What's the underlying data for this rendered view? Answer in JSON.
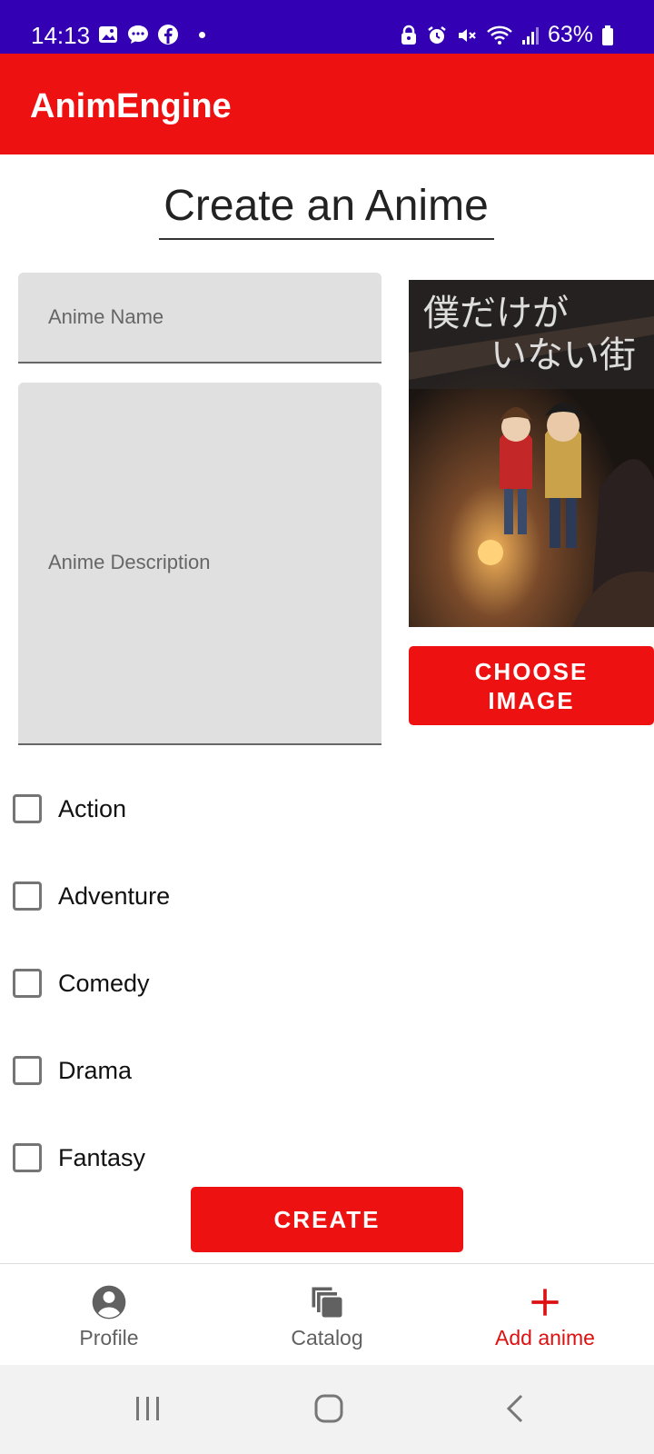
{
  "status_bar": {
    "time": "14:13",
    "battery": "63%",
    "left_icons": [
      "gallery-icon",
      "chat-bubble-icon",
      "facebook-icon",
      "dot-icon"
    ],
    "right_icons": [
      "lock-icon",
      "alarm-icon",
      "mute-icon",
      "wifi-icon",
      "signal-icon",
      "battery-icon"
    ]
  },
  "app_bar": {
    "title": "AnimEngine"
  },
  "page": {
    "title": "Create an Anime"
  },
  "form": {
    "name_placeholder": "Anime Name",
    "name_value": "",
    "description_placeholder": "Anime Description",
    "description_value": "",
    "poster_caption": "僕だけが\nいない街",
    "choose_image_label": "CHOOSE\nIMAGE"
  },
  "genres": [
    {
      "label": "Action",
      "checked": false
    },
    {
      "label": "Adventure",
      "checked": false
    },
    {
      "label": "Comedy",
      "checked": false
    },
    {
      "label": "Drama",
      "checked": false
    },
    {
      "label": "Fantasy",
      "checked": false
    }
  ],
  "create_label": "CREATE",
  "bottom_nav": {
    "items": [
      {
        "label": "Profile",
        "icon": "account-circle-icon",
        "active": false
      },
      {
        "label": "Catalog",
        "icon": "catalog-stack-icon",
        "active": false
      },
      {
        "label": "Add anime",
        "icon": "plus-icon",
        "active": true
      }
    ]
  },
  "colors": {
    "status_bar": "#3300b3",
    "accent": "#ee1111",
    "field_bg": "#e0e0e0",
    "nav_inactive": "#616161",
    "nav_active": "#dd1111"
  }
}
